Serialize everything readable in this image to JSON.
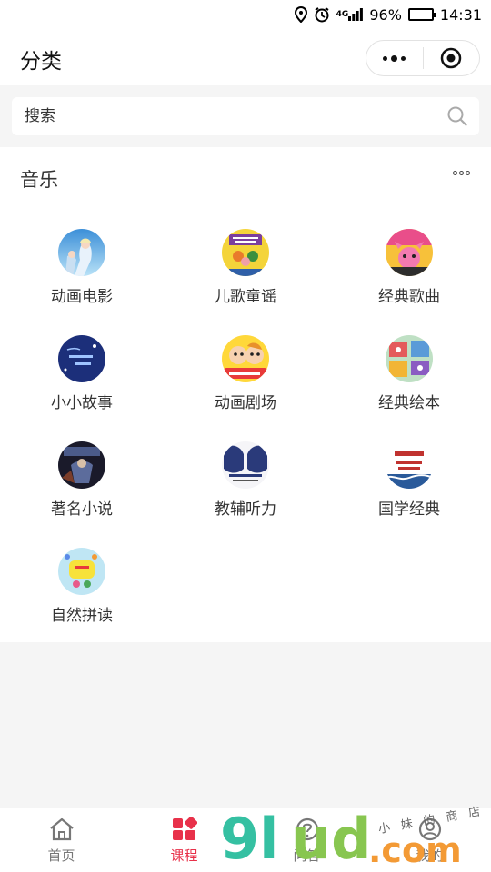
{
  "status_bar": {
    "network": "4G",
    "battery_text": "96%",
    "battery_level": 0.96,
    "time": "14:31"
  },
  "nav": {
    "title": "分类",
    "more_icon": "more-dots-icon",
    "close_icon": "target-icon"
  },
  "search": {
    "placeholder": "搜索",
    "icon": "search-icon"
  },
  "section": {
    "title": "音乐",
    "more_icon": "more-dots-icon",
    "categories": [
      {
        "label": "动画电影",
        "icon": "frozen-thumbnail"
      },
      {
        "label": "儿歌童谣",
        "icon": "nursery-rhymes-thumbnail"
      },
      {
        "label": "经典歌曲",
        "icon": "pinkfong-thumbnail"
      },
      {
        "label": "小小故事",
        "icon": "english-story-thumbnail"
      },
      {
        "label": "动画剧场",
        "icon": "caillou-thumbnail"
      },
      {
        "label": "经典绘本",
        "icon": "picture-book-thumbnail"
      },
      {
        "label": "著名小说",
        "icon": "harry-potter-thumbnail"
      },
      {
        "label": "教辅听力",
        "icon": "cd-listening-thumbnail"
      },
      {
        "label": "国学经典",
        "icon": "chinese-classics-thumbnail"
      },
      {
        "label": "自然拼读",
        "icon": "phonics-thumbnail"
      }
    ]
  },
  "tab_bar": {
    "tabs": [
      {
        "label": "首页",
        "icon": "home-icon",
        "active": false
      },
      {
        "label": "课程",
        "icon": "course-grid-icon",
        "active": true
      },
      {
        "label": "问答",
        "icon": "question-icon",
        "active": false
      },
      {
        "label": "我的",
        "icon": "user-icon",
        "active": false
      }
    ]
  },
  "watermark": {
    "logo_text": "9lud.com",
    "tagline": "小 妹 的 商 店"
  },
  "colors": {
    "accent": "#e8314a",
    "battery": "#21c021"
  }
}
